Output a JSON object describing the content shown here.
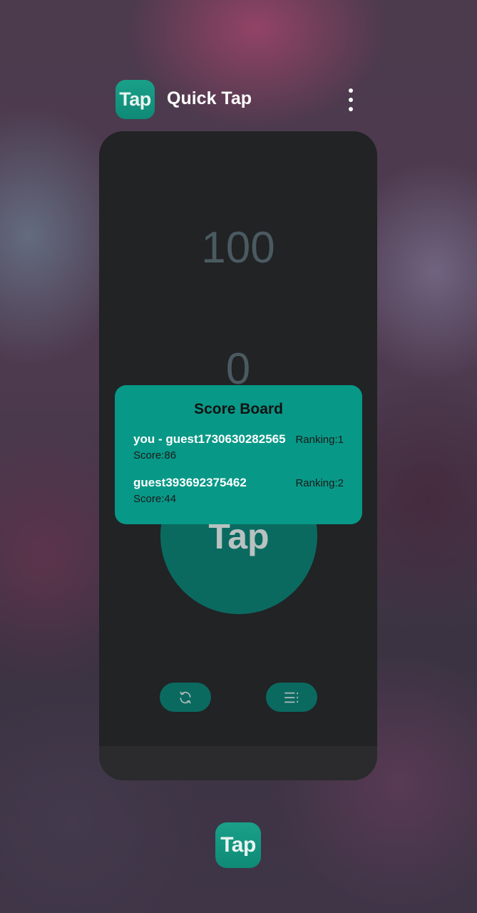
{
  "header": {
    "app_icon_label": "Tap",
    "app_title": "Quick Tap",
    "more_icon": "more-vertical-icon"
  },
  "game": {
    "timer": "100",
    "tap_count": "0",
    "tap_button_label": "Tap",
    "refresh_icon": "refresh-icon",
    "leaderboard_icon": "list-icon"
  },
  "scoreboard": {
    "title": "Score Board",
    "entries": [
      {
        "name": "you - guest1730630282565",
        "ranking": "Ranking:1",
        "score": "Score:86"
      },
      {
        "name": "guest393692375462",
        "ranking": "Ranking:2",
        "score": "Score:44"
      }
    ]
  },
  "dock": {
    "app_icon_label": "Tap"
  },
  "colors": {
    "accent": "#089887",
    "button_dark": "#0a6a60",
    "card_bg": "#212325"
  }
}
